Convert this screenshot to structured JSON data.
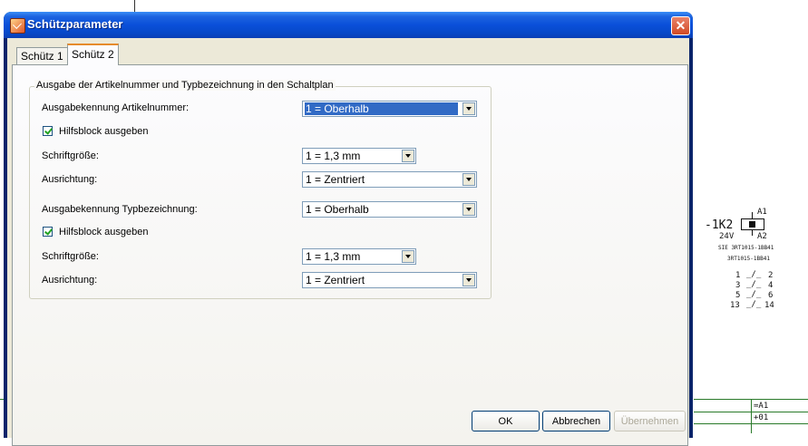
{
  "window": {
    "title": "Schützparameter",
    "close_glyph": "✕"
  },
  "tabs": [
    {
      "label": "Schütz 1"
    },
    {
      "label": "Schütz 2"
    }
  ],
  "group": {
    "legend": "Ausgabe der Artikelnummer und Typbezeichnung in den Schaltplan",
    "article": {
      "label": "Ausgabekennung Artikelnummer:",
      "value": "1 = Oberhalb",
      "aux_label": "Hilfsblock ausgeben",
      "aux_checked": true,
      "font_size_label": "Schriftgröße:",
      "font_size_value": "1 = 1,3 mm",
      "alignment_label": "Ausrichtung:",
      "alignment_value": "1 = Zentriert"
    },
    "type": {
      "label": "Ausgabekennung Typbezeichnung:",
      "value": "1 = Oberhalb",
      "aux_label": "Hilfsblock ausgeben",
      "aux_checked": true,
      "font_size_label": "Schriftgröße:",
      "font_size_value": "1 = 1,3 mm",
      "alignment_label": "Ausrichtung:",
      "alignment_value": "1 = Zentriert"
    }
  },
  "buttons": {
    "ok": "OK",
    "cancel": "Abbrechen",
    "apply": "Übernehmen"
  },
  "schematic": {
    "device": "-1K2",
    "voltage": "24V",
    "a1": "A1",
    "a2": "A2",
    "line1": "SIE 3RT1015-1BB41",
    "line2": "3RT1015-1BB41",
    "contacts": [
      {
        "left": "1",
        "right": "2"
      },
      {
        "left": "3",
        "right": "4"
      },
      {
        "left": "5",
        "right": "6"
      },
      {
        "left": "13",
        "right": "14"
      }
    ]
  },
  "title_block": {
    "row1": "=A1",
    "row2": "+01"
  }
}
